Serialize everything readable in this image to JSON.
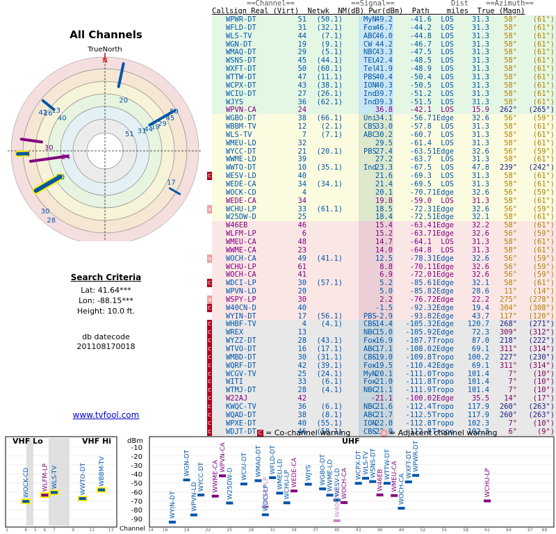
{
  "left": {
    "title": "All Channels",
    "compass_label": "TrueNorth",
    "north_label": "N",
    "criteria_heading": "Search Criteria",
    "lat": "Lat: 41.64***",
    "lon": "Lon: -88.15***",
    "height": "Height: 10.0 ft.",
    "db_label": "db datecode",
    "db_code": "201108170018",
    "website": "www.tvfool.com"
  },
  "polar_labels": [
    {
      "text": "20",
      "az": 20,
      "r": 0.58,
      "c": "#0055aa"
    },
    {
      "text": "42",
      "az": 302,
      "r": 0.78,
      "c": "#0055aa"
    },
    {
      "text": "16",
      "az": 304,
      "r": 0.73,
      "c": "#0055aa"
    },
    {
      "text": "13",
      "az": 310,
      "r": 0.68,
      "c": "#0055aa"
    },
    {
      "text": "40",
      "az": 308,
      "r": 0.58,
      "c": "#0055aa"
    },
    {
      "text": "50",
      "az": 60,
      "r": 0.85,
      "c": "#0055aa"
    },
    {
      "text": "45",
      "az": 63,
      "r": 0.78,
      "c": "#0055aa"
    },
    {
      "text": "29",
      "az": 64,
      "r": 0.68,
      "c": "#0055aa"
    },
    {
      "text": "19",
      "az": 64,
      "r": 0.6,
      "c": "#0055aa"
    },
    {
      "text": "44",
      "az": 63,
      "r": 0.52,
      "c": "#0055aa"
    },
    {
      "text": "31",
      "az": 61,
      "r": 0.45,
      "c": "#0055aa"
    },
    {
      "text": "51",
      "az": 55,
      "r": 0.32,
      "c": "#0055aa"
    },
    {
      "text": "30",
      "az": 274,
      "r": 0.6,
      "c": "#800080"
    },
    {
      "text": "4",
      "az": 268,
      "r": 0.82,
      "c": "#0055aa"
    },
    {
      "text": "24",
      "az": 262,
      "r": 0.42,
      "c": "#800080"
    },
    {
      "text": "10",
      "az": 240,
      "r": 0.55,
      "c": "#0055aa"
    },
    {
      "text": "17",
      "az": 115,
      "r": 0.78,
      "c": "#0055aa"
    },
    {
      "text": "30",
      "az": 225,
      "r": 0.9,
      "c": "#0055aa"
    },
    {
      "text": "28",
      "az": 218,
      "r": 0.93,
      "c": "#0055aa"
    }
  ],
  "table": {
    "header1": "        ==Channel==             ==Signal==             Dist    ==Azimuth==",
    "header2": "Callsign Real (Virt)  Netwk  NM(dB) Pwr(dBm)  Path    miles  True (Magn)",
    "rows": [
      [
        "WPWR-DT",
        "51",
        "(50.1)",
        "MyN",
        "49.2",
        "-41.6",
        "LOS",
        "31.3",
        "58°",
        "(61°)",
        "g",
        "#0055aa",
        ""
      ],
      [
        "WFLD-DT",
        "31",
        "(32.1)",
        "Fox",
        "46.7",
        "-44.2",
        "LOS",
        "31.3",
        "58°",
        "(61°)",
        "g",
        "#0055aa",
        ""
      ],
      [
        "WLS-TV",
        "44",
        "(7.1)",
        "ABC",
        "46.0",
        "-44.8",
        "LOS",
        "31.3",
        "58°",
        "(61°)",
        "g",
        "#0055aa",
        ""
      ],
      [
        "WGN-DT",
        "19",
        "(9.1)",
        "CW",
        "44.2",
        "-46.7",
        "LOS",
        "31.3",
        "58°",
        "(61°)",
        "g",
        "#0055aa",
        ""
      ],
      [
        "WMAQ-DT",
        "29",
        "(5.1)",
        "NBC",
        "43.3",
        "-47.5",
        "LOS",
        "31.3",
        "58°",
        "(61°)",
        "g",
        "#0055aa",
        ""
      ],
      [
        "WSNS-DT",
        "45",
        "(44.1)",
        "TEL",
        "42.4",
        "-48.5",
        "LOS",
        "31.3",
        "58°",
        "(61°)",
        "g",
        "#0055aa",
        ""
      ],
      [
        "WXFT-DT",
        "50",
        "(60.1)",
        "Tel",
        "41.9",
        "-48.9",
        "LOS",
        "31.3",
        "58°",
        "(61°)",
        "g",
        "#0055aa",
        ""
      ],
      [
        "WTTW-DT",
        "47",
        "(11.1)",
        "PBS",
        "40.4",
        "-50.4",
        "LOS",
        "31.3",
        "58°",
        "(61°)",
        "g",
        "#0055aa",
        ""
      ],
      [
        "WCPX-DT",
        "43",
        "(38.1)",
        "ION",
        "40.3",
        "-50.5",
        "LOS",
        "31.3",
        "58°",
        "(61°)",
        "g",
        "#0055aa",
        ""
      ],
      [
        "WCIU-DT",
        "27",
        "(26.1)",
        "Ind",
        "39.7",
        "-51.2",
        "LOS",
        "31.3",
        "58°",
        "(61°)",
        "g",
        "#0055aa",
        ""
      ],
      [
        "WJYS",
        "36",
        "(62.1)",
        "Ind",
        "39.3",
        "-51.5",
        "LOS",
        "31.3",
        "58°",
        "(61°)",
        "g",
        "#0055aa",
        ""
      ],
      [
        "WPVN-CA",
        "24",
        "",
        "",
        "36.8",
        "-42.1",
        "LOS",
        "15.9",
        "262°",
        "(265°)",
        "g",
        "#800080",
        ""
      ],
      [
        "WGBO-DT",
        "38",
        "(66.1)",
        "Uni",
        "34.1",
        "-56.7",
        "1Edge",
        "32.6",
        "56°",
        "(59°)",
        "y",
        "#0055aa",
        ""
      ],
      [
        "WBBM-TV",
        "12",
        "(2.1)",
        "CBS",
        "33.0",
        "-57.8",
        "LOS",
        "31.3",
        "58°",
        "(61°)",
        "y",
        "#0055aa",
        ""
      ],
      [
        "WLS-TV",
        "7",
        "(7.1)",
        "ABC",
        "30.2",
        "-60.7",
        "LOS",
        "31.3",
        "58°",
        "(61°)",
        "y",
        "#0055aa",
        ""
      ],
      [
        "WMEU-LD",
        "32",
        "",
        "",
        "29.5",
        "-61.4",
        "LOS",
        "31.3",
        "58°",
        "(61°)",
        "y",
        "#0055aa",
        ""
      ],
      [
        "WYCC-DT",
        "21",
        "(20.1)",
        "PBS",
        "27.4",
        "-63.5",
        "1Edge",
        "32.6",
        "56°",
        "(59°)",
        "y",
        "#0055aa",
        ""
      ],
      [
        "WWME-LD",
        "39",
        "",
        "",
        "27.2",
        "-63.7",
        "LOS",
        "31.3",
        "58°",
        "(61°)",
        "y",
        "#0055aa",
        ""
      ],
      [
        "WWTO-DT",
        "10",
        "(35.1)",
        "Ind",
        "23.3",
        "-67.5",
        "LOS",
        "47.8",
        "239°",
        "(242°)",
        "y",
        "#0055aa",
        ""
      ],
      [
        "WESV-LD",
        "40",
        "",
        "",
        "21.6",
        "-69.3",
        "LOS",
        "31.3",
        "58°",
        "(61°)",
        "y",
        "#0055aa",
        "C"
      ],
      [
        "WEDE-CA",
        "34",
        "(34.1)",
        "",
        "21.4",
        "-69.5",
        "LOS",
        "31.3",
        "58°",
        "(61°)",
        "y",
        "#0055aa",
        ""
      ],
      [
        "WOCK-CD",
        "4",
        "",
        "",
        "20.1",
        "-70.7",
        "1Edge",
        "32.6",
        "56°",
        "(59°)",
        "y",
        "#0055aa",
        ""
      ],
      [
        "WEDE-CA",
        "34",
        "",
        "",
        "19.8",
        "-59.0",
        "LOS",
        "31.3",
        "58°",
        "(61°)",
        "y",
        "#800080",
        ""
      ],
      [
        "WCHU-LP",
        "33",
        "(61.1)",
        "",
        "18.5",
        "-72.3",
        "1Edge",
        "32.6",
        "56°",
        "(59°)",
        "y",
        "#0055aa",
        "a"
      ],
      [
        "W25DW-D",
        "25",
        "",
        "",
        "18.4",
        "-72.5",
        "1Edge",
        "32.1",
        "58°",
        "(61°)",
        "y",
        "#0055aa",
        ""
      ],
      [
        "W46EB",
        "46",
        "",
        "",
        "15.4",
        "-63.4",
        "1Edge",
        "32.2",
        "58°",
        "(61°)",
        "p",
        "#800080",
        ""
      ],
      [
        "WLFM-LP",
        "6",
        "",
        "",
        "15.2",
        "-63.7",
        "1Edge",
        "32.6",
        "56°",
        "(59°)",
        "p",
        "#800080",
        ""
      ],
      [
        "WMEU-CA",
        "48",
        "",
        "",
        "14.7",
        "-64.1",
        "LOS",
        "31.3",
        "58°",
        "(61°)",
        "p",
        "#800080",
        ""
      ],
      [
        "WWME-CA",
        "23",
        "",
        "",
        "14.0",
        "-64.8",
        "LOS",
        "31.3",
        "58°",
        "(61°)",
        "p",
        "#800080",
        ""
      ],
      [
        "WOCH-CA",
        "49",
        "(41.1)",
        "",
        "12.5",
        "-78.3",
        "1Edge",
        "32.6",
        "56°",
        "(59°)",
        "p",
        "#0055aa",
        "a"
      ],
      [
        "WCHU-LP",
        "61",
        "",
        "",
        "8.8",
        "-70.1",
        "1Edge",
        "32.6",
        "56°",
        "(59°)",
        "p",
        "#800080",
        ""
      ],
      [
        "WOCH-CA",
        "41",
        "",
        "",
        "6.9",
        "-72.0",
        "1Edge",
        "32.6",
        "56°",
        "(59°)",
        "p",
        "#800080",
        ""
      ],
      [
        "WDCI-LP",
        "30",
        "(57.1)",
        "",
        "5.2",
        "-85.6",
        "1Edge",
        "32.1",
        "58°",
        "(61°)",
        "p",
        "#0055aa",
        "C"
      ],
      [
        "WPVN-LD",
        "20",
        "",
        "",
        "5.0",
        "-85.8",
        "2Edge",
        "28.6",
        "11°",
        "(14°)",
        "p",
        "#0055aa",
        ""
      ],
      [
        "WSPY-LP",
        "30",
        "",
        "",
        "2.2",
        "-76.7",
        "2Edge",
        "22.2",
        "275°",
        "(278°)",
        "p",
        "#800080",
        "a"
      ],
      [
        "W40CN-D",
        "40",
        "",
        "",
        "-1.5",
        "-92.3",
        "2Edge",
        "19.4",
        "304°",
        "(308°)",
        "p",
        "#0055aa",
        "C"
      ],
      [
        "WYIN-DT",
        "17",
        "(56.1)",
        "PBS",
        "-2.9",
        "-93.8",
        "2Edge",
        "43.7",
        "117°",
        "(120°)",
        "p",
        "#0055aa",
        ""
      ],
      [
        "WHBF-TV",
        "4",
        "(4.1)",
        "CBS",
        "-14.4",
        "-105.3",
        "2Edge",
        "120.7",
        "268°",
        "(271°)",
        "w",
        "#0055aa",
        "C"
      ],
      [
        "WREX",
        "13",
        "",
        "NBC",
        "-15.0",
        "-105.9",
        "2Edge",
        "72.3",
        "309°",
        "(312°)",
        "w",
        "#0055aa",
        "C"
      ],
      [
        "WYZZ-DT",
        "28",
        "(43.1)",
        "Fox",
        "-16.9",
        "-107.7",
        "Tropo",
        "87.0",
        "218°",
        "(222°)",
        "w",
        "#0055aa",
        "C"
      ],
      [
        "WTVO-DT",
        "16",
        "(17.1)",
        "ABC",
        "-17.1",
        "-108.0",
        "2Edge",
        "69.1",
        "311°",
        "(314°)",
        "w",
        "#0055aa",
        "C"
      ],
      [
        "WMBD-DT",
        "30",
        "(31.1)",
        "CBS",
        "-19.0",
        "-109.8",
        "Tropo",
        "100.2",
        "227°",
        "(230°)",
        "w",
        "#0055aa",
        "C"
      ],
      [
        "WQRF-DT",
        "42",
        "(39.1)",
        "Fox",
        "-19.5",
        "-110.4",
        "2Edge",
        "69.1",
        "311°",
        "(314°)",
        "w",
        "#0055aa",
        "C"
      ],
      [
        "WCGV-TV",
        "25",
        "(24.1)",
        "MyN",
        "-20.1",
        "-111.0",
        "Tropo",
        "101.4",
        "7°",
        "(10°)",
        "w",
        "#0055aa",
        "C"
      ],
      [
        "WITI",
        "33",
        "(6.1)",
        "Fox",
        "-21.0",
        "-111.8",
        "Tropo",
        "101.4",
        "7°",
        "(10°)",
        "w",
        "#0055aa",
        "C"
      ],
      [
        "WTMJ-DT",
        "28",
        "(4.1)",
        "NBC",
        "-21.1",
        "-111.9",
        "Tropo",
        "101.4",
        "7°",
        "(10°)",
        "w",
        "#0055aa",
        "C"
      ],
      [
        "W22AJ",
        "42",
        "",
        "",
        "-21.1",
        "-100.0",
        "2Edge",
        "35.5",
        "14°",
        "(17°)",
        "w",
        "#800080",
        "C"
      ],
      [
        "KWQC-TV",
        "36",
        "(6.1)",
        "NBC",
        "-21.6",
        "-112.4",
        "Tropo",
        "117.9",
        "260°",
        "(263°)",
        "w",
        "#0055aa",
        "C"
      ],
      [
        "WQAD-DT",
        "38",
        "(8.1)",
        "ABC",
        "-21.7",
        "-112.5",
        "Tropo",
        "117.9",
        "260°",
        "(263°)",
        "w",
        "#0055aa",
        "C"
      ],
      [
        "WPXE-DT",
        "40",
        "(55.1)",
        "ION",
        "-22.0",
        "-112.8",
        "Tropo",
        "102.3",
        "7°",
        "(10°)",
        "w",
        "#0055aa",
        "C"
      ],
      [
        "WDJT-DT",
        "46",
        "(58.1)",
        "CBS",
        "-22.0",
        "-112.8",
        "Tropo",
        "102.3",
        "6°",
        "(9°)",
        "w",
        "#0055aa",
        "C"
      ]
    ]
  },
  "bottom": {
    "vhf_lo": "VHF Lo",
    "vhf_hi": "VHF Hi",
    "uhf": "UHF",
    "dbm": "dBm",
    "channel_label": "Channel",
    "legend_co": "= Co-channel warning",
    "legend_adj": "= Adjacent channel warning",
    "dbm_ticks": [
      "-10",
      "-20",
      "-30",
      "-40",
      "-50",
      "-60",
      "-70",
      "-80",
      "-90"
    ],
    "vhf_ticks": [
      "2",
      "4",
      "5",
      "6",
      "7",
      "9",
      "11",
      "13"
    ],
    "uhf_ticks": [
      "14",
      "16",
      "19",
      "22",
      "25",
      "28",
      "31",
      "34",
      "37",
      "40",
      "43",
      "46",
      "49",
      "52",
      "55",
      "58",
      "61",
      "64",
      "67",
      "69"
    ],
    "vhf_bars": [
      {
        "name": "WOCK-CD",
        "ch": 4,
        "pwr": -70.7,
        "c": "#0055aa"
      },
      {
        "name": "WLFM-LP",
        "ch": 6,
        "pwr": -63.7,
        "c": "#800080"
      },
      {
        "name": "WLS-TV",
        "ch": 7,
        "pwr": -60.7,
        "c": "#0055aa"
      },
      {
        "name": "WWTO-DT",
        "ch": 10,
        "pwr": -67.5,
        "c": "#0055aa"
      },
      {
        "name": "WBBM-TV",
        "ch": 12,
        "pwr": -57.8,
        "c": "#0055aa"
      }
    ],
    "uhf_bars": [
      {
        "name": "WYIN-DT",
        "ch": 17,
        "pwr": -93.8,
        "c": "#0055aa"
      },
      {
        "name": "WGN-DT",
        "ch": 19,
        "pwr": -46.7,
        "c": "#0055aa"
      },
      {
        "name": "WPVN-LD",
        "ch": 20,
        "pwr": -85.8,
        "c": "#0055aa"
      },
      {
        "name": "WYCC-DT",
        "ch": 21,
        "pwr": -63.5,
        "c": "#0055aa"
      },
      {
        "name": "WWME-CA",
        "ch": 23,
        "pwr": -64.8,
        "c": "#800080"
      },
      {
        "name": "WPVN-CA",
        "ch": 24,
        "pwr": -42.1,
        "c": "#800080"
      },
      {
        "name": "W25DW-D",
        "ch": 25,
        "pwr": -72.5,
        "c": "#0055aa"
      },
      {
        "name": "WCIU-DT",
        "ch": 27,
        "pwr": -51.2,
        "c": "#0055aa"
      },
      {
        "name": "WMAQ-DT",
        "ch": 29,
        "pwr": -47.5,
        "c": "#0055aa"
      },
      {
        "name": "WSPY-LP",
        "ch": 30,
        "pwr": -76.7,
        "c": "#cc88cc"
      },
      {
        "name": "WDCI-LP",
        "ch": 30,
        "pwr": -85.6,
        "c": "#0055aa"
      },
      {
        "name": "WFLD-DT",
        "ch": 31,
        "pwr": -44.2,
        "c": "#0055aa"
      },
      {
        "name": "WMEU-LD",
        "ch": 32,
        "pwr": -61.4,
        "c": "#0055aa"
      },
      {
        "name": "WCHU-LP",
        "ch": 33,
        "pwr": -72.3,
        "c": "#0055aa"
      },
      {
        "name": "WEDE-CA",
        "ch": 34,
        "pwr": -59.0,
        "c": "#800080"
      },
      {
        "name": "WJYS",
        "ch": 36,
        "pwr": -51.5,
        "c": "#0055aa"
      },
      {
        "name": "WGBO-DT",
        "ch": 38,
        "pwr": -56.7,
        "c": "#0055aa"
      },
      {
        "name": "WWME-LD",
        "ch": 39,
        "pwr": -63.7,
        "c": "#0055aa"
      },
      {
        "name": "WESV-LD",
        "ch": 40,
        "pwr": -69.3,
        "c": "#0055aa"
      },
      {
        "name": "W40CN-D",
        "ch": 40,
        "pwr": -92.3,
        "c": "#cc88cc"
      },
      {
        "name": "WOCH-CA",
        "ch": 41,
        "pwr": -72.0,
        "c": "#800080"
      },
      {
        "name": "WCPX-DT",
        "ch": 43,
        "pwr": -50.5,
        "c": "#0055aa"
      },
      {
        "name": "WLS-TV",
        "ch": 44,
        "pwr": -44.8,
        "c": "#0055aa"
      },
      {
        "name": "WSNS-DT",
        "ch": 45,
        "pwr": -48.5,
        "c": "#0055aa"
      },
      {
        "name": "W46EB",
        "ch": 46,
        "pwr": -63.4,
        "c": "#800080"
      },
      {
        "name": "WTTW-DT",
        "ch": 47,
        "pwr": -50.4,
        "c": "#0055aa"
      },
      {
        "name": "WMEU-CA",
        "ch": 48,
        "pwr": -64.1,
        "c": "#800080"
      },
      {
        "name": "WOCH-CA",
        "ch": 49,
        "pwr": -78.3,
        "c": "#0055aa"
      },
      {
        "name": "WXFT-DT",
        "ch": 50,
        "pwr": -48.9,
        "c": "#0055aa"
      },
      {
        "name": "WPWR-DT",
        "ch": 51,
        "pwr": -41.6,
        "c": "#0055aa"
      },
      {
        "name": "WCHU-LP",
        "ch": 61,
        "pwr": -70.1,
        "c": "#800080"
      }
    ]
  }
}
